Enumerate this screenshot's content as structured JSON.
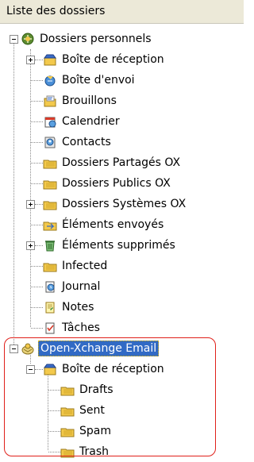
{
  "header": {
    "title": "Liste des dossiers"
  },
  "tree": {
    "personal": {
      "label": "Dossiers personnels"
    },
    "items": [
      {
        "label": "Boîte de réception"
      },
      {
        "label": "Boîte d'envoi"
      },
      {
        "label": "Brouillons"
      },
      {
        "label": "Calendrier"
      },
      {
        "label": "Contacts"
      },
      {
        "label": "Dossiers Partagés OX"
      },
      {
        "label": "Dossiers Publics OX"
      },
      {
        "label": "Dossiers Systèmes OX"
      },
      {
        "label": "Éléments envoyés"
      },
      {
        "label": "Éléments supprimés"
      },
      {
        "label": "Infected"
      },
      {
        "label": "Journal"
      },
      {
        "label": "Notes"
      },
      {
        "label": "Tâches"
      }
    ],
    "email_account": {
      "label": "Open-Xchange Email"
    },
    "email_inbox": {
      "label": "Boîte de réception"
    },
    "email_folders": [
      {
        "label": "Drafts"
      },
      {
        "label": "Sent"
      },
      {
        "label": "Spam"
      },
      {
        "label": "Trash"
      }
    ]
  },
  "colors": {
    "selection": "#316ac5",
    "highlight_outline": "#e0201a",
    "header_bg": "#ece9d8",
    "folder": "#f3c94c"
  }
}
